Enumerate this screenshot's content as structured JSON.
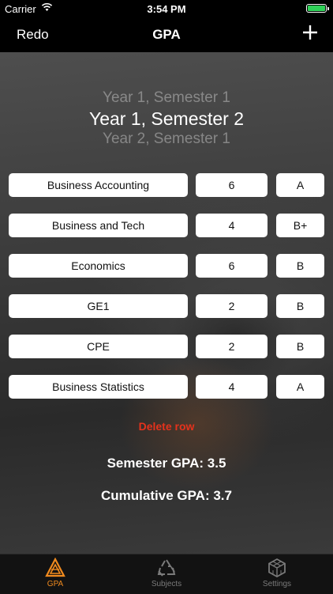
{
  "status": {
    "carrier": "Carrier",
    "time": "3:54 PM"
  },
  "nav": {
    "left": "Redo",
    "title": "GPA",
    "right_icon": "plus-icon"
  },
  "picker": {
    "above": "Year 1, Semester 1",
    "selected": "Year 1, Semester 2",
    "below": "Year 2, Semester 1"
  },
  "rows": [
    {
      "subject": "Business Accounting",
      "credits": "6",
      "grade": "A"
    },
    {
      "subject": "Business and Tech",
      "credits": "4",
      "grade": "B+"
    },
    {
      "subject": "Economics",
      "credits": "6",
      "grade": "B"
    },
    {
      "subject": "GE1",
      "credits": "2",
      "grade": "B"
    },
    {
      "subject": "CPE",
      "credits": "2",
      "grade": "B"
    },
    {
      "subject": "Business Statistics",
      "credits": "4",
      "grade": "A"
    }
  ],
  "delete_label": "Delete row",
  "semester_gpa": "Semester GPA: 3.5",
  "cumulative_gpa": "Cumulative GPA: 3.7",
  "tabs": [
    {
      "label": "GPA",
      "icon": "gpa-triangle-icon",
      "active": true
    },
    {
      "label": "Subjects",
      "icon": "subjects-recycle-icon",
      "active": false
    },
    {
      "label": "Settings",
      "icon": "settings-cube-icon",
      "active": false
    }
  ],
  "colors": {
    "accent": "#f08a1e",
    "delete": "#e5321c",
    "battery": "#2fd158"
  }
}
